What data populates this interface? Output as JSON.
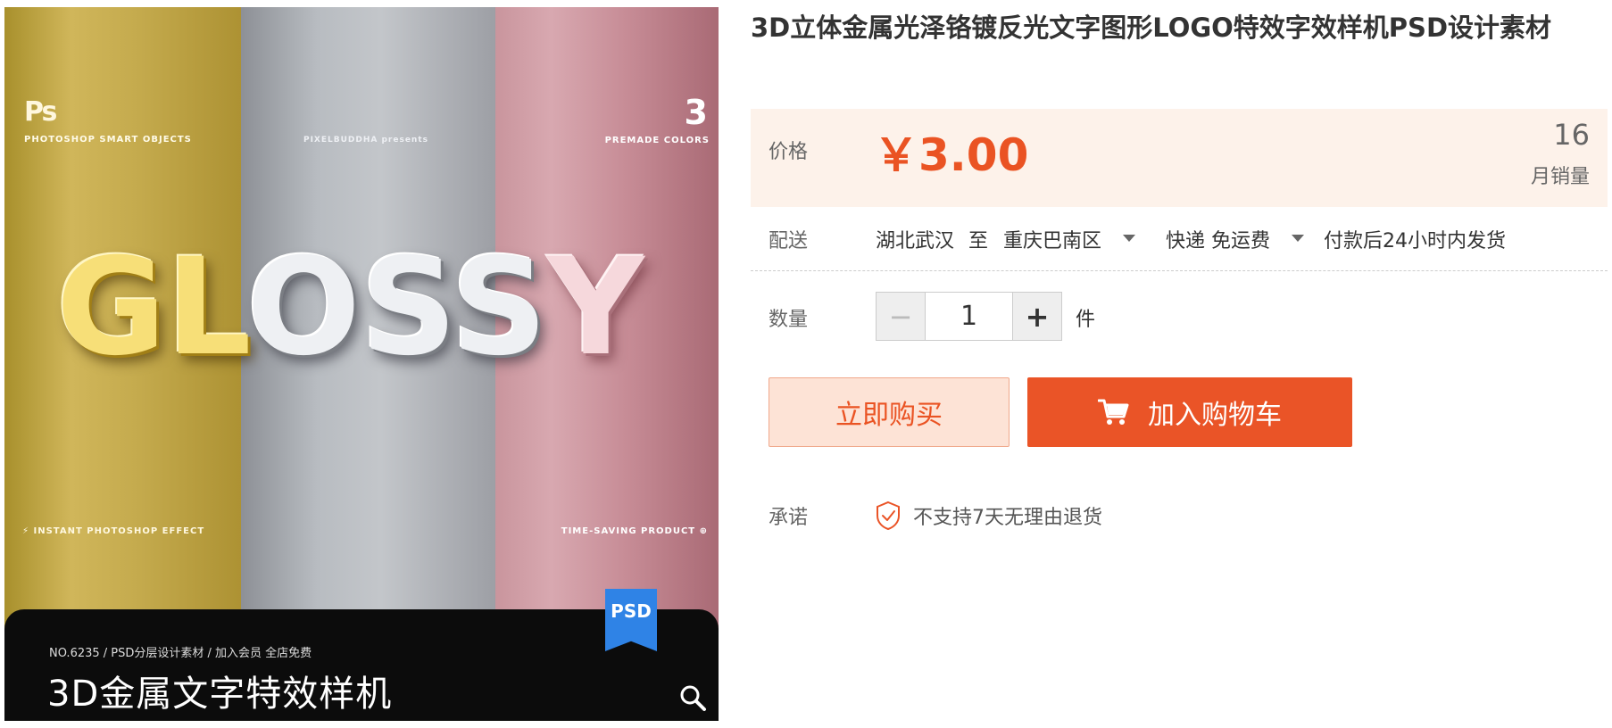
{
  "product_image": {
    "ps_logo": "Ps",
    "ps_caption": "PHOTOSHOP SMART OBJECTS",
    "brand_caption": "PIXELBUDDHA presents",
    "premade_count": "3",
    "premade_caption": "PREMADE COLORS",
    "headline_gold": "GL",
    "headline_silver": "OSS",
    "headline_rose": "Y",
    "left_feature": "⚡ INSTANT PHOTOSHOP EFFECT",
    "right_feature": "TIME-SAVING PRODUCT ⊕",
    "bar_subtitle": "NO.6235 / PSD分层设计素材 / 加入会员 全店免费",
    "bar_title": "3D金属文字特效样机",
    "badge": "PSD",
    "zoom_icon": "search-icon"
  },
  "product": {
    "title": "3D立体金属光泽铬镀反光文字图形LOGO特效字效样机PSD设计素材"
  },
  "price": {
    "label": "价格",
    "value": "￥3.00",
    "monthly_sales": "16",
    "monthly_sales_label": "月销量"
  },
  "shipping": {
    "label": "配送",
    "from": "湖北武汉",
    "to_word": "至",
    "destination": "重庆巴南区",
    "method": "快递 免运费",
    "dispatch": "付款后24小时内发货"
  },
  "quantity": {
    "label": "数量",
    "minus": "−",
    "value": "1",
    "plus": "+",
    "unit": "件"
  },
  "actions": {
    "buy_now": "立即购买",
    "add_to_cart": "加入购物车"
  },
  "promise": {
    "label": "承诺",
    "text": "不支持7天无理由退货"
  },
  "colors": {
    "accent": "#ea5427",
    "price_bg": "#fdf2ea",
    "buy_now_bg": "#fde3d6"
  }
}
